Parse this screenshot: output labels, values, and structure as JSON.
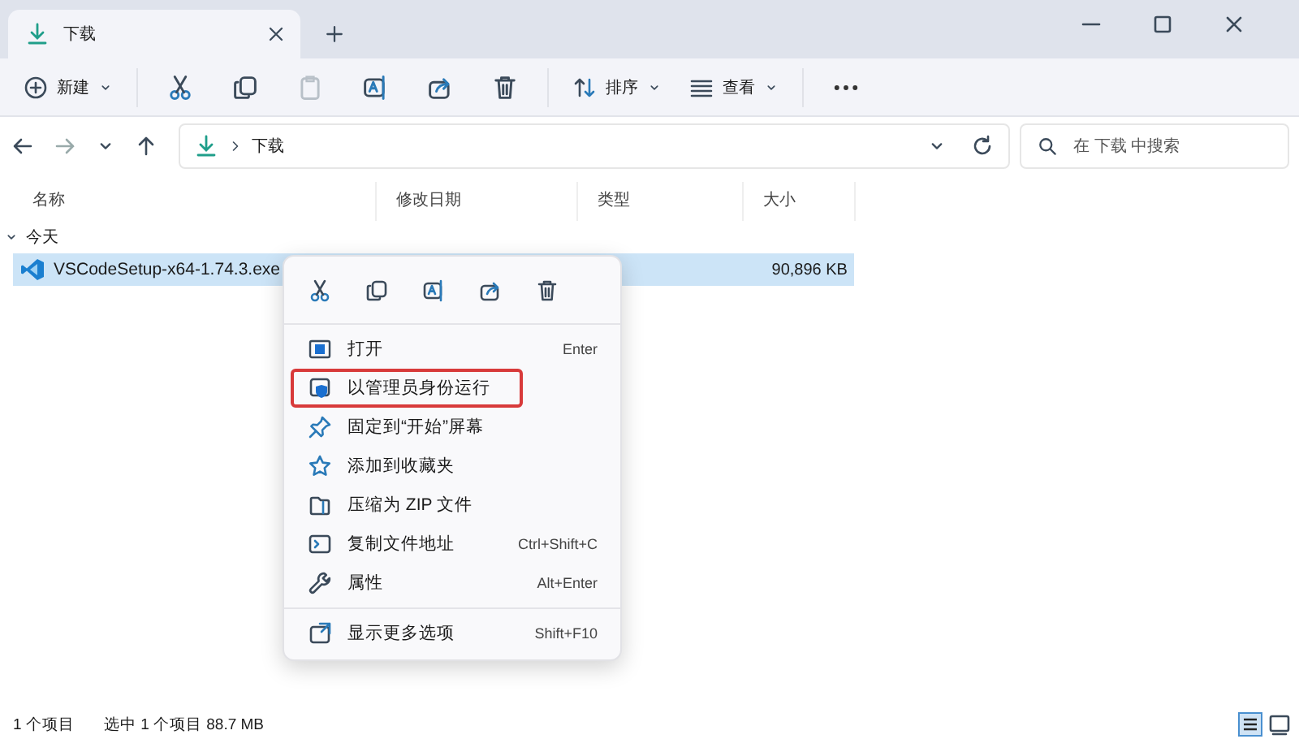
{
  "window": {
    "tab": {
      "title": "下载"
    }
  },
  "toolbar": {
    "new": "新建",
    "sort": "排序",
    "view": "查看"
  },
  "address": {
    "path": "下载",
    "search_placeholder": "在 下载 中搜索"
  },
  "table": {
    "columns": [
      "名称",
      "修改日期",
      "类型",
      "大小"
    ],
    "groups": [
      {
        "label": "今天",
        "expanded": true,
        "rows": [
          {
            "name": "VSCodeSetup-x64-1.74.3.exe",
            "size": "90,896 KB",
            "selected": true
          }
        ]
      }
    ]
  },
  "context_menu": {
    "items": [
      {
        "kind": "open",
        "label": "打开",
        "shortcut": "Enter",
        "marked": false
      },
      {
        "kind": "shield",
        "label": "以管理员身份运行",
        "marked": true
      },
      {
        "kind": "pin",
        "label": "固定到“开始”屏幕",
        "marked": false
      },
      {
        "kind": "star",
        "label": "添加到收藏夹",
        "marked": false
      },
      {
        "kind": "zip",
        "label": "压缩为 ZIP 文件",
        "marked": false
      },
      {
        "kind": "path",
        "label": "复制文件地址",
        "shortcut": "Ctrl+Shift+C",
        "marked": false
      },
      {
        "kind": "wrench",
        "label": "属性",
        "shortcut": "Alt+Enter",
        "marked": false
      },
      {
        "kind": "more",
        "label": "显示更多选项",
        "shortcut": "Shift+F10",
        "marked": false,
        "separated": true
      }
    ]
  },
  "status_bar": {
    "count": "1 个项目",
    "selection": "选中 1 个项目  88.7 MB"
  }
}
